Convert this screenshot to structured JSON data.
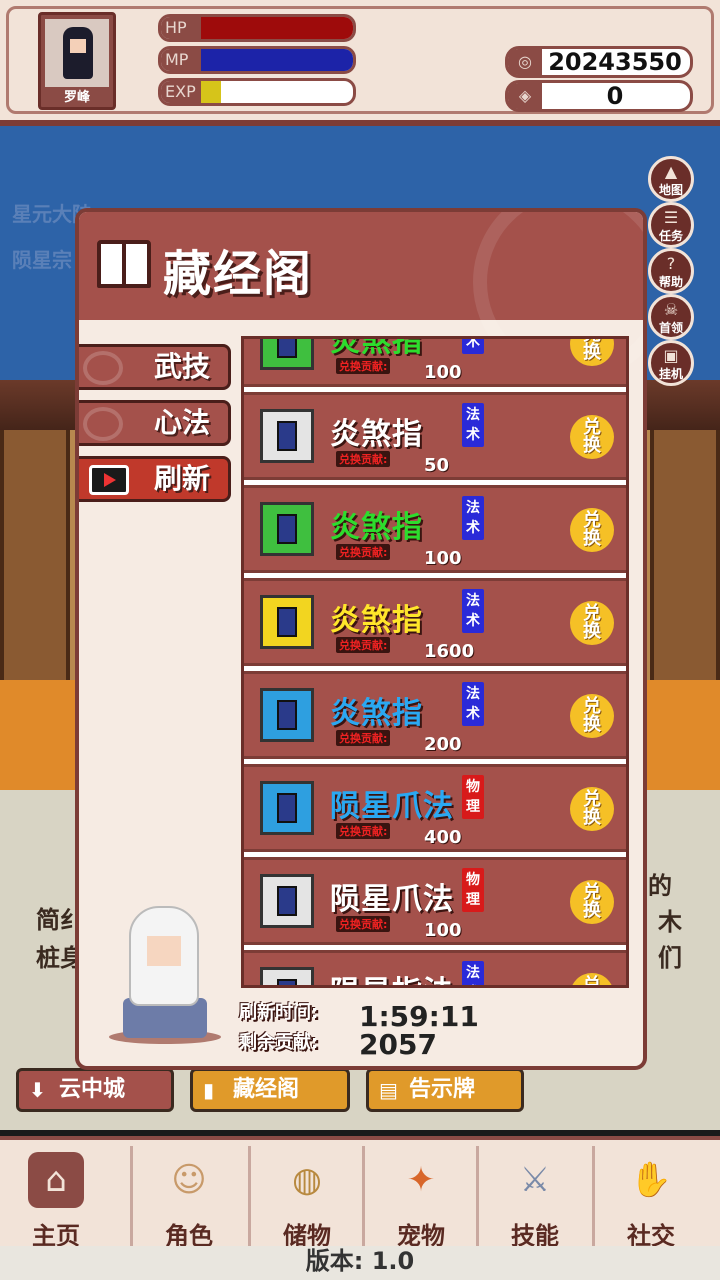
{
  "player": {
    "name": "罗峰",
    "hp_label": "HP",
    "mp_label": "MP",
    "exp_label": "EXP",
    "hp_fraction": 1.0,
    "mp_fraction": 1.0,
    "exp_fraction": 0.13,
    "hp_color": "#9e0b0b",
    "mp_color": "#1c23a8",
    "exp_color": "#d6c41a"
  },
  "currency": {
    "coins": "20243550",
    "gems": "0"
  },
  "background": {
    "location_line1": "星元大陆",
    "location_line2": "陨星宗",
    "text_left_1": "简纟",
    "text_left_2": "桩身",
    "text_right_1": "的",
    "text_right_2": "木",
    "text_right_3": "们"
  },
  "side_buttons": [
    {
      "label": "地图",
      "icon": "mountain-icon"
    },
    {
      "label": "任务",
      "icon": "scroll-icon"
    },
    {
      "label": "帮助",
      "icon": "question-icon"
    },
    {
      "label": "首领",
      "icon": "demon-icon"
    },
    {
      "label": "挂机",
      "icon": "monitor-icon"
    }
  ],
  "dialog": {
    "title": "藏经阁",
    "tabs": {
      "martial": "武技",
      "mind": "心法",
      "refresh": "刷新"
    },
    "cost_label": "兑换贡献:",
    "exchange_label_1": "兑",
    "exchange_label_2": "换",
    "items": [
      {
        "name": "炎煞指",
        "type_1": "法",
        "type_2": "术",
        "cost": "100",
        "rarity": "green",
        "name_color": "#2ddc2d",
        "icon_bg": "#3fbf3f",
        "type_color": "#2a2ad8"
      },
      {
        "name": "炎煞指",
        "type_1": "法",
        "type_2": "术",
        "cost": "50",
        "rarity": "white",
        "name_color": "#ffffff",
        "icon_bg": "#e4e4e4",
        "type_color": "#2a2ad8"
      },
      {
        "name": "炎煞指",
        "type_1": "法",
        "type_2": "术",
        "cost": "100",
        "rarity": "green",
        "name_color": "#2ddc2d",
        "icon_bg": "#3fbf3f",
        "type_color": "#2a2ad8"
      },
      {
        "name": "炎煞指",
        "type_1": "法",
        "type_2": "术",
        "cost": "1600",
        "rarity": "yellow",
        "name_color": "#ffe62a",
        "icon_bg": "#f2d520",
        "type_color": "#2a2ad8"
      },
      {
        "name": "炎煞指",
        "type_1": "法",
        "type_2": "术",
        "cost": "200",
        "rarity": "blue",
        "name_color": "#2aa8f2",
        "icon_bg": "#2e9fe0",
        "type_color": "#2a2ad8"
      },
      {
        "name": "陨星爪法",
        "type_1": "物",
        "type_2": "理",
        "cost": "400",
        "rarity": "blue",
        "name_color": "#2aa8f2",
        "icon_bg": "#2e9fe0",
        "type_color": "#d81a1a"
      },
      {
        "name": "陨星爪法",
        "type_1": "物",
        "type_2": "理",
        "cost": "100",
        "rarity": "white",
        "name_color": "#ffffff",
        "icon_bg": "#e4e4e4",
        "type_color": "#d81a1a"
      },
      {
        "name": "陨星指法",
        "type_1": "法",
        "type_2": "术",
        "cost": "",
        "rarity": "white",
        "name_color": "#ffffff",
        "icon_bg": "#e4e4e4",
        "type_color": "#2a2ad8"
      }
    ],
    "refresh_time_label": "刷新时间:",
    "refresh_time": "1:59:11",
    "remaining_label": "剩余贡献:",
    "remaining": "2057"
  },
  "sub_nav": {
    "cloud_city": "云中城",
    "library": "藏经阁",
    "notice": "告示牌"
  },
  "tabs": [
    {
      "label": "主页",
      "icon": "house-icon"
    },
    {
      "label": "角色",
      "icon": "character-icon"
    },
    {
      "label": "储物",
      "icon": "bag-icon"
    },
    {
      "label": "宠物",
      "icon": "fox-icon"
    },
    {
      "label": "技能",
      "icon": "sword-icon"
    },
    {
      "label": "社交",
      "icon": "handshake-icon"
    }
  ],
  "version": "版本: 1.0"
}
